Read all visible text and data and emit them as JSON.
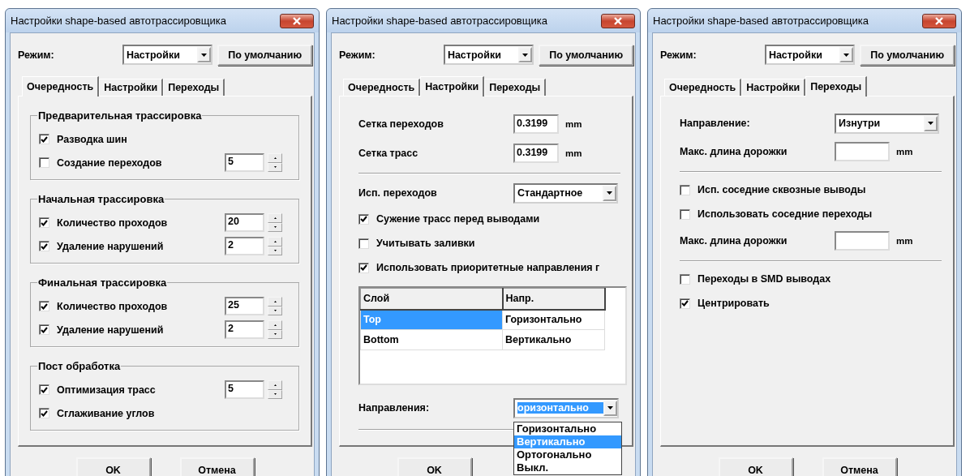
{
  "dialogs": [
    {
      "title": "Настройки shape-based автотрассировщика",
      "mode_label": "Режим:",
      "mode_value": "Настройки",
      "default_button": "По умолчанию",
      "tabs": [
        {
          "label": "Очередность",
          "selected": true
        },
        {
          "label": "Настройки",
          "selected": false
        },
        {
          "label": "Переходы",
          "selected": false
        }
      ],
      "content": [
        {
          "kind": "group",
          "title": "Предварительная трассировка",
          "items": [
            {
              "label": "Разводка шин",
              "checked": true
            },
            {
              "label": "Создание переходов",
              "checked": false,
              "spin": "5"
            }
          ]
        },
        {
          "kind": "group",
          "title": "Начальная трассировка",
          "items": [
            {
              "label": "Количество проходов",
              "checked": true,
              "spin": "20"
            },
            {
              "label": "Удаление нарушений",
              "checked": true,
              "spin": "2"
            }
          ]
        },
        {
          "kind": "group",
          "title": "Финальная трассировка",
          "items": [
            {
              "label": "Количество проходов",
              "checked": true,
              "spin": "25"
            },
            {
              "label": "Удаление нарушений",
              "checked": true,
              "spin": "2"
            }
          ]
        },
        {
          "kind": "group",
          "title": "Пост обработка",
          "items": [
            {
              "label": "Оптимизация трасс",
              "checked": true,
              "spin": "5"
            },
            {
              "label": "Сглаживание углов",
              "checked": true
            }
          ]
        }
      ],
      "buttons": [
        "OK",
        "Отмена"
      ]
    },
    {
      "title": "Настройки shape-based автотрассировщика",
      "mode_label": "Режим:",
      "mode_value": "Настройки",
      "default_button": "По умолчанию",
      "tabs": [
        {
          "label": "Очередность",
          "selected": false
        },
        {
          "label": "Настройки",
          "selected": true
        },
        {
          "label": "Переходы",
          "selected": false
        }
      ],
      "content": [
        {
          "kind": "field",
          "label": "Сетка переходов",
          "value": "0.3199",
          "unit": "mm"
        },
        {
          "kind": "field",
          "label": "Сетка трасс",
          "value": "0.3199",
          "unit": "mm"
        },
        {
          "kind": "separator"
        },
        {
          "kind": "combo",
          "label": "Исп. переходов",
          "value": "Стандартное"
        },
        {
          "kind": "checkbox",
          "label": "Сужение трасс перед выводами",
          "checked": true
        },
        {
          "kind": "checkbox",
          "label": "Учитывать заливки",
          "checked": false
        },
        {
          "kind": "checkbox",
          "label": "Использовать приоритетные направления г",
          "checked": true
        },
        {
          "kind": "table",
          "columns": [
            "Слой",
            "Напр."
          ],
          "rows": [
            {
              "cells": [
                "Top",
                "Горизонтально"
              ],
              "selected": true
            },
            {
              "cells": [
                "Bottom",
                "Вертикально"
              ],
              "selected": false
            }
          ]
        },
        {
          "kind": "dropdown",
          "label": "Направления:",
          "value": "оризонтально",
          "value_highlighted": true,
          "options": [
            {
              "label": "Горизонтально",
              "selected": false
            },
            {
              "label": "Вертикально",
              "selected": true
            },
            {
              "label": "Ортогонально",
              "selected": false
            },
            {
              "label": "Выкл.",
              "selected": false
            }
          ]
        },
        {
          "kind": "separator"
        }
      ],
      "buttons": [
        "OK"
      ]
    },
    {
      "title": "Настройки shape-based автотрассировщика",
      "mode_label": "Режим:",
      "mode_value": "Настройки",
      "default_button": "По умолчанию",
      "tabs": [
        {
          "label": "Очередность",
          "selected": false
        },
        {
          "label": "Настройки",
          "selected": false
        },
        {
          "label": "Переходы",
          "selected": true
        }
      ],
      "content": [
        {
          "kind": "combo",
          "label": "Направление:",
          "value": "Изнутри"
        },
        {
          "kind": "field",
          "label": "Макс. длина дорожки",
          "unit": "mm"
        },
        {
          "kind": "separator"
        },
        {
          "kind": "checkbox",
          "label": "Исп. соседние сквозные выводы",
          "checked": false
        },
        {
          "kind": "checkbox",
          "label": "Использовать соседние переходы",
          "checked": false
        },
        {
          "kind": "field",
          "label": "Макс. длина дорожки",
          "unit": "mm"
        },
        {
          "kind": "separator"
        },
        {
          "kind": "checkbox",
          "label": "Переходы в SMD выводах",
          "checked": false
        },
        {
          "kind": "checkbox",
          "label": "Центрировать",
          "checked": true
        }
      ],
      "buttons": [
        "OK",
        "Отмена"
      ]
    }
  ]
}
